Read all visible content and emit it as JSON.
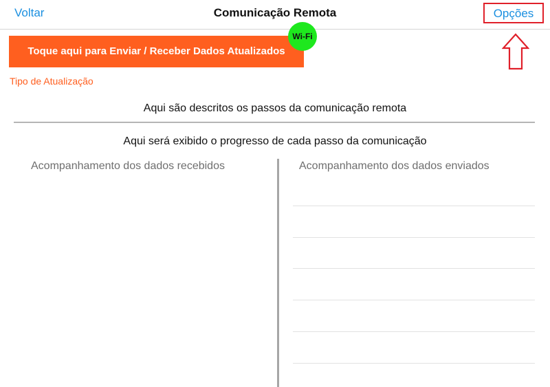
{
  "navbar": {
    "back_label": "Voltar",
    "title": "Comunicação Remota",
    "options_label": "Opções",
    "highlight_color": "#e0202a",
    "link_color": "#1a8fe0"
  },
  "sync": {
    "button_label": "Toque aqui para Enviar / Receber Dados Atualizados",
    "button_color": "#ff5f1f",
    "connection_badge": "Wi-Fi",
    "badge_color": "#1ee81e"
  },
  "update_type_label": "Tipo de Atualização",
  "steps_description": "Aqui são descritos os passos da comunicação remota",
  "progress_description": "Aqui será exibido o progresso de cada passo da comunicação",
  "columns": {
    "received_header": "Acompanhamento dos dados recebidos",
    "sent_header": "Acompanhamento dos dados enviados"
  },
  "icons": {
    "callout": "arrow-up-outline-icon"
  }
}
